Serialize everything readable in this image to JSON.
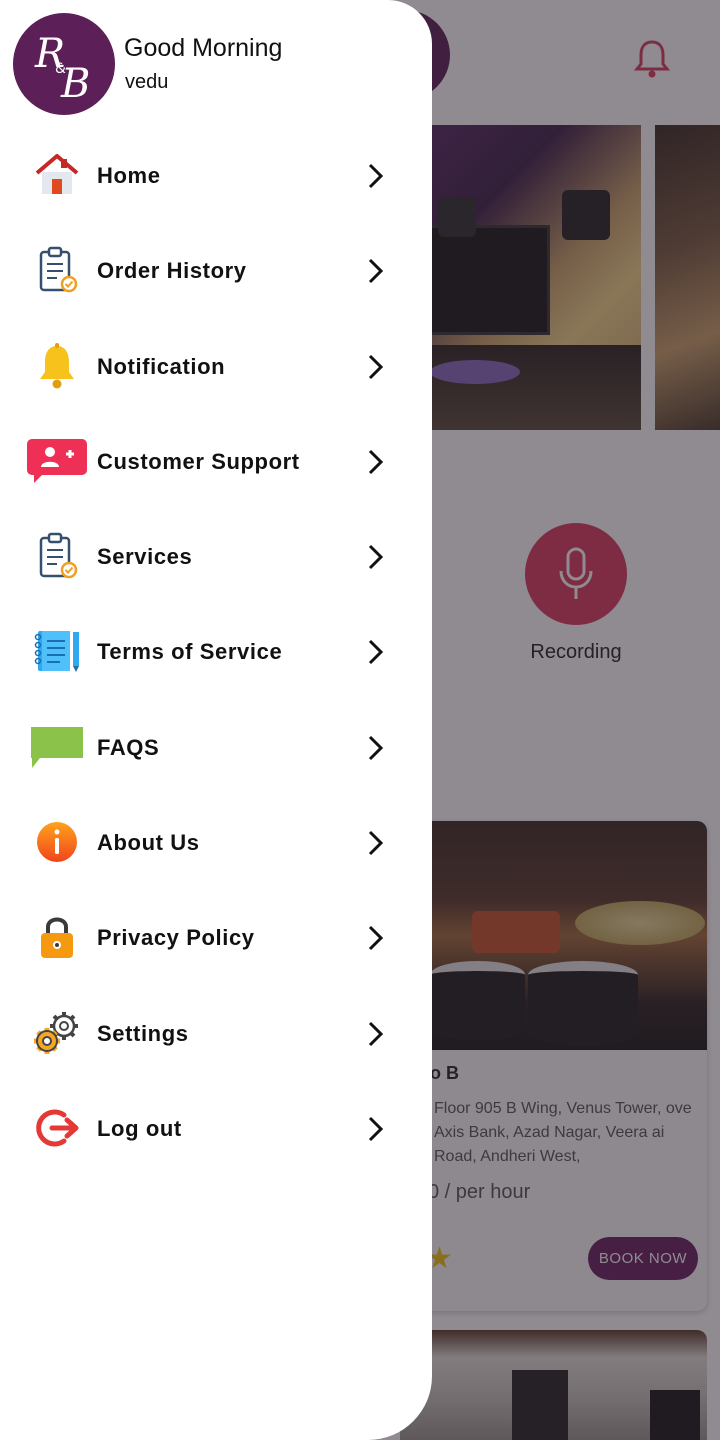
{
  "drawer": {
    "greeting": "Good Morning",
    "username": "vedu",
    "logo_text": "R&B",
    "items": [
      {
        "label": "Home",
        "icon": "home-icon"
      },
      {
        "label": "Order History",
        "icon": "clipboard-check-icon"
      },
      {
        "label": "Notification",
        "icon": "bell-icon"
      },
      {
        "label": "Customer Support",
        "icon": "add-user-chat-icon"
      },
      {
        "label": "Services",
        "icon": "clipboard-check-icon"
      },
      {
        "label": "Terms of Service",
        "icon": "notebook-icon"
      },
      {
        "label": "FAQS",
        "icon": "speech-bubble-icon"
      },
      {
        "label": "About Us",
        "icon": "info-icon"
      },
      {
        "label": "Privacy Policy",
        "icon": "lock-icon"
      },
      {
        "label": "Settings",
        "icon": "gear-icon"
      },
      {
        "label": "Log out",
        "icon": "logout-icon"
      }
    ]
  },
  "background": {
    "service_label": "Recording",
    "studio_title": "o B",
    "studio_address": "Floor 905 B Wing, Venus Tower, ove Axis Bank, Azad Nagar, Veera ai Road, Andheri West,",
    "price": "0 / per hour",
    "book_button": "BOOK NOW"
  },
  "colors": {
    "brand_purple": "#5d1f58",
    "accent_red": "#d93a5e",
    "faq_green": "#8bc34a"
  }
}
